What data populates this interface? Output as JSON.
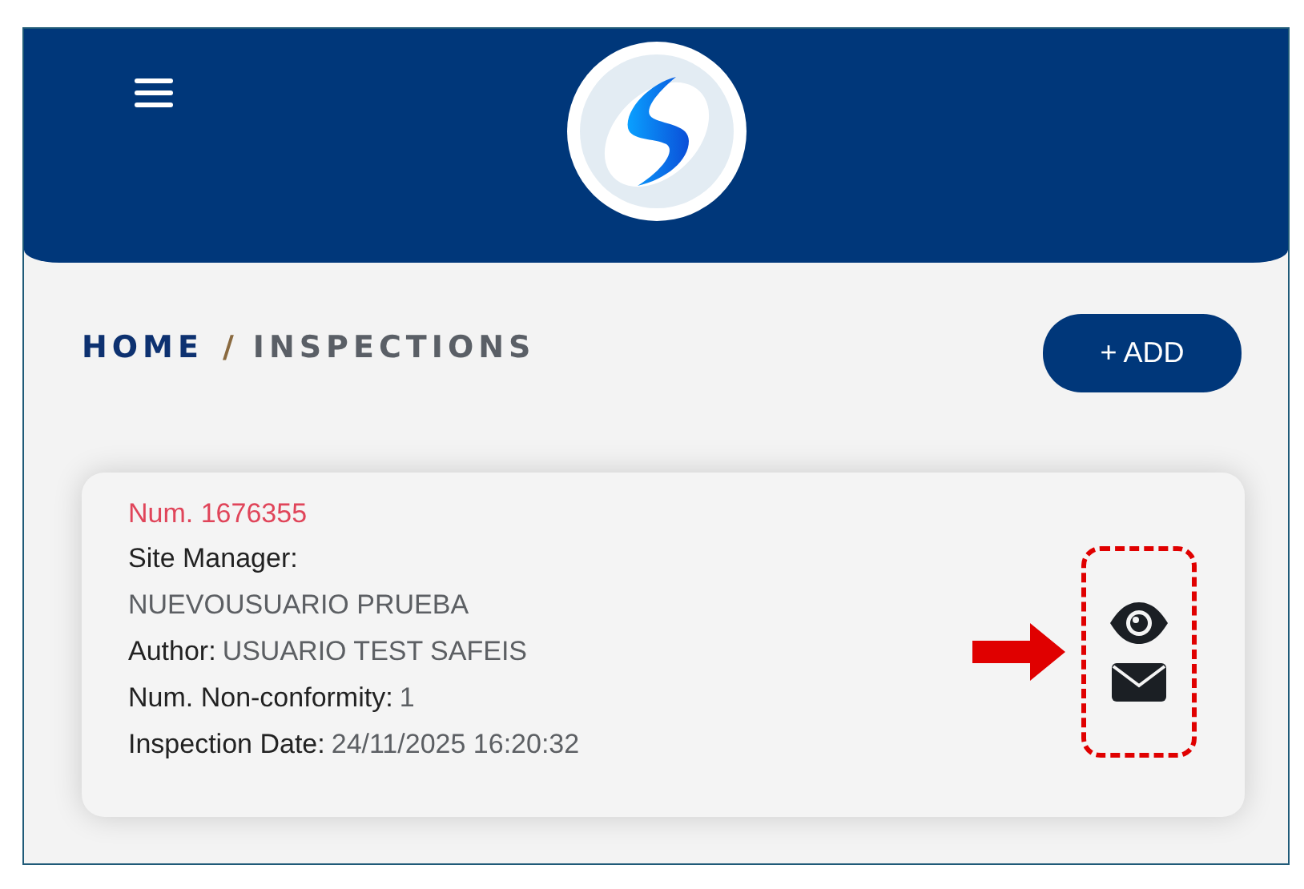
{
  "breadcrumb": [
    {
      "label": "HOME",
      "selected": false
    },
    {
      "label": "INSPECTIONS",
      "selected": true
    }
  ],
  "breadcrumb_separator": "/",
  "add_button": "+ ADD",
  "inspections": [
    {
      "number": "Num. 1676355",
      "fields": [
        {
          "kind": "stacked",
          "label": "Site Manager:",
          "value": "NUEVOUSUARIO PRUEBA"
        },
        {
          "kind": "inline",
          "label": "Author:",
          "value": "USUARIO TEST SAFEIS"
        },
        {
          "kind": "inline",
          "label": "Num. Non-conformity:",
          "value": "1"
        },
        {
          "kind": "inline",
          "label": "Inspection Date:",
          "value": "24/11/2025 16:20:32"
        }
      ],
      "actions": [
        {
          "kind": "view"
        },
        {
          "kind": "email"
        }
      ],
      "highlighted": true
    }
  ]
}
